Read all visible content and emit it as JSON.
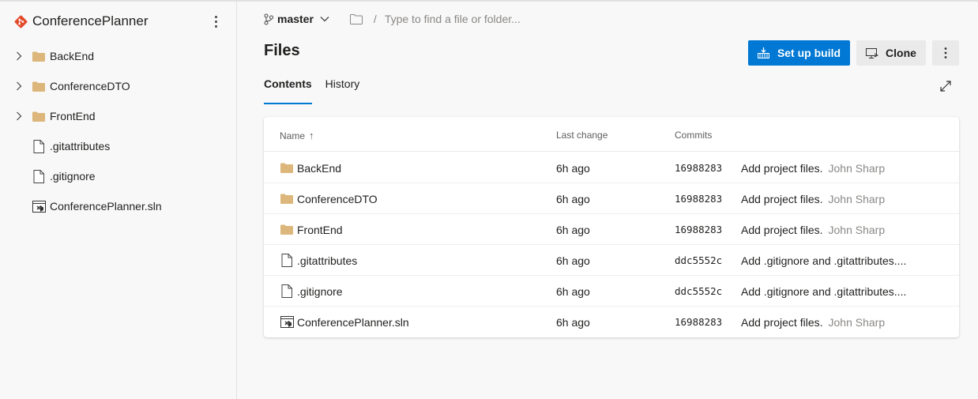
{
  "sidebar": {
    "repo_name": "ConferencePlanner",
    "items": [
      {
        "label": "BackEnd",
        "type": "folder",
        "expandable": true
      },
      {
        "label": "ConferenceDTO",
        "type": "folder",
        "expandable": true
      },
      {
        "label": "FrontEnd",
        "type": "folder",
        "expandable": true
      },
      {
        "label": ".gitattributes",
        "type": "file",
        "expandable": false
      },
      {
        "label": ".gitignore",
        "type": "file",
        "expandable": false
      },
      {
        "label": "ConferencePlanner.sln",
        "type": "solution",
        "expandable": false
      }
    ]
  },
  "header": {
    "branch": "master",
    "path_placeholder": "Type to find a file or folder...",
    "separator": "/"
  },
  "page": {
    "title": "Files",
    "setup_build_label": "Set up build",
    "clone_label": "Clone",
    "tabs": [
      {
        "label": "Contents",
        "active": true
      },
      {
        "label": "History",
        "active": false
      }
    ]
  },
  "table": {
    "columns": {
      "name": "Name",
      "sort_indicator": "↑",
      "last_change": "Last change",
      "commits": "Commits"
    },
    "rows": [
      {
        "name": "BackEnd",
        "type": "folder",
        "last_change": "6h ago",
        "commit": "16988283",
        "message": "Add project files.",
        "author": "John Sharp"
      },
      {
        "name": "ConferenceDTO",
        "type": "folder",
        "last_change": "6h ago",
        "commit": "16988283",
        "message": "Add project files.",
        "author": "John Sharp"
      },
      {
        "name": "FrontEnd",
        "type": "folder",
        "last_change": "6h ago",
        "commit": "16988283",
        "message": "Add project files.",
        "author": "John Sharp"
      },
      {
        "name": ".gitattributes",
        "type": "file",
        "last_change": "6h ago",
        "commit": "ddc5552c",
        "message": "Add .gitignore and .gitattributes....",
        "author": ""
      },
      {
        "name": ".gitignore",
        "type": "file",
        "last_change": "6h ago",
        "commit": "ddc5552c",
        "message": "Add .gitignore and .gitattributes....",
        "author": ""
      },
      {
        "name": "ConferencePlanner.sln",
        "type": "solution",
        "last_change": "6h ago",
        "commit": "16988283",
        "message": "Add project files.",
        "author": "John Sharp"
      }
    ]
  },
  "colors": {
    "accent": "#0078d4",
    "git_logo": "#e24b2c",
    "folder": "#dcb67a",
    "muted_text": "#8a8886"
  },
  "icons": {
    "repo": "git-logo-icon",
    "branch": "branch-icon",
    "folder": "folder-icon",
    "file": "file-icon",
    "solution": "solution-file-icon",
    "build": "build-icon",
    "clone": "clone-icon",
    "more": "more-vertical-icon",
    "expand": "expand-icon"
  }
}
